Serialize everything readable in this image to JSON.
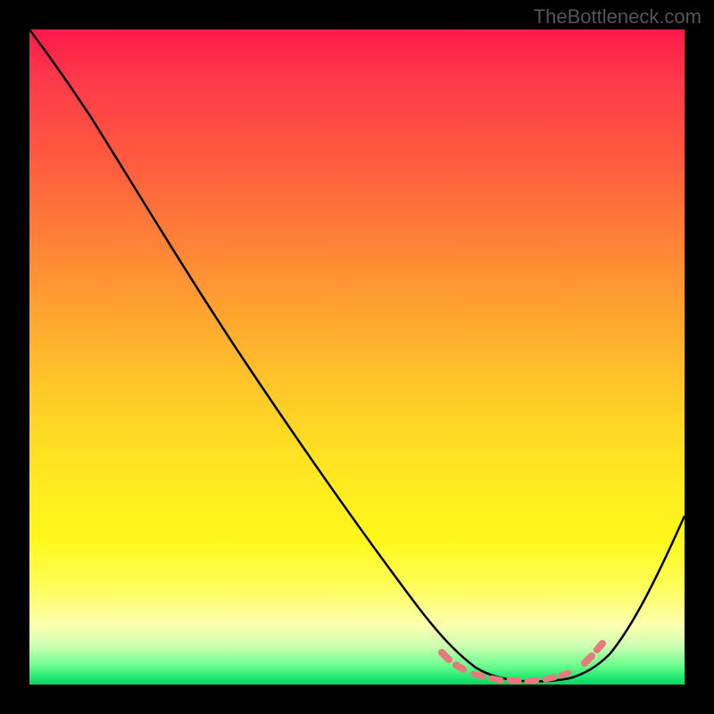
{
  "watermark": "TheBottleneck.com",
  "chart_data": {
    "type": "line",
    "title": "",
    "xlabel": "",
    "ylabel": "",
    "xlim": [
      0,
      100
    ],
    "ylim": [
      0,
      100
    ],
    "series": [
      {
        "name": "curve",
        "x": [
          0,
          5,
          10,
          15,
          20,
          25,
          30,
          35,
          40,
          45,
          50,
          55,
          60,
          65,
          68,
          70,
          72,
          75,
          78,
          80,
          83,
          86,
          90,
          95,
          100
        ],
        "y": [
          100,
          95,
          89,
          82,
          75,
          68,
          61,
          54,
          47,
          39,
          32,
          25,
          18,
          11,
          7,
          5,
          3.5,
          2,
          1.3,
          1,
          1.3,
          2.5,
          6,
          15,
          27
        ]
      }
    ],
    "highlight_range_x": [
      63,
      87
    ],
    "grid": false,
    "legend": false
  }
}
